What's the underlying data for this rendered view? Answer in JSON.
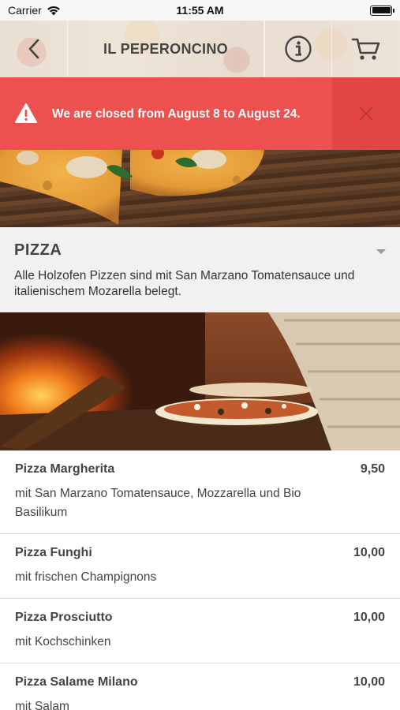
{
  "status_bar": {
    "carrier": "Carrier",
    "time": "11:55 AM"
  },
  "header": {
    "title": "IL PEPERONCINO"
  },
  "alert": {
    "message": "We are closed from August 8 to August 24."
  },
  "category": {
    "title": "PIZZA",
    "description": "Alle Holzofen Pizzen sind mit San Marzano Tomatensauce und italienischem Mozarella belegt."
  },
  "menu": {
    "items": [
      {
        "name": "Pizza Margherita",
        "price": "9,50",
        "description": "mit San Marzano Tomatensauce, Mozzarella und Bio Basilikum"
      },
      {
        "name": "Pizza Funghi",
        "price": "10,00",
        "description": "mit frischen Champignons"
      },
      {
        "name": "Pizza Prosciutto",
        "price": "10,00",
        "description": "mit Kochschinken"
      },
      {
        "name": "Pizza Salame Milano",
        "price": "10,00",
        "description": "mit Salam"
      }
    ]
  },
  "colors": {
    "alert_bg": "#ec5150",
    "alert_close_bg": "#e14645",
    "category_bg": "#f1f1f1"
  },
  "icons": [
    "wifi-icon",
    "battery-icon",
    "back-chevron-icon",
    "info-icon",
    "cart-icon",
    "warning-icon",
    "close-icon",
    "chevron-down-icon"
  ]
}
